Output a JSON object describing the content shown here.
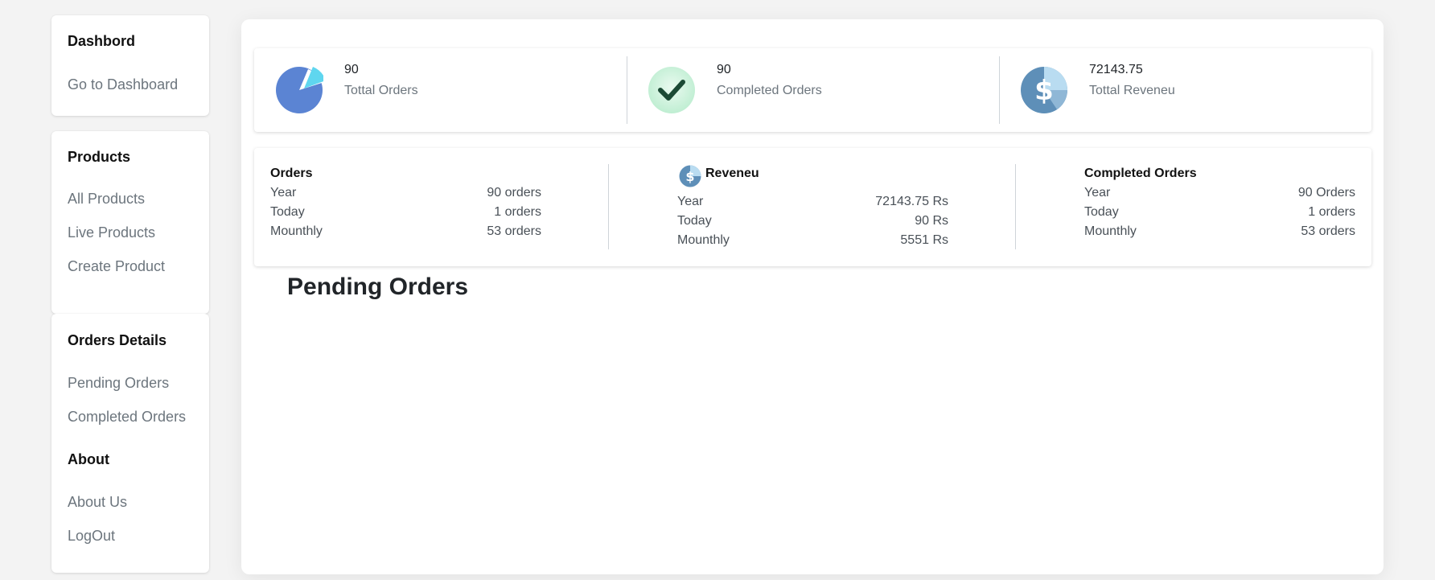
{
  "sidebar": {
    "dashboard": {
      "heading": "Dashbord",
      "links": [
        "Go to Dashboard"
      ]
    },
    "products": {
      "heading": "Products",
      "links": [
        "All Products",
        "Live Products",
        "Create Product"
      ]
    },
    "orders": {
      "heading": "Orders Details",
      "links": [
        "Pending Orders",
        "Completed Orders"
      ]
    },
    "about": {
      "heading": "About",
      "links": [
        "About Us",
        "LogOut"
      ]
    }
  },
  "stats": [
    {
      "value": "90",
      "label": "Tottal Orders",
      "icon": "pie-chart-icon"
    },
    {
      "value": "90",
      "label": "Completed Orders",
      "icon": "check-icon"
    },
    {
      "value": "72143.75",
      "label": "Tottal Reveneu",
      "icon": "dollar-coin-icon"
    }
  ],
  "details": {
    "orders": {
      "title": "Orders",
      "rows": [
        {
          "key": "Year",
          "value": "90 orders"
        },
        {
          "key": "Today",
          "value": "1 orders"
        },
        {
          "key": "Mounthly",
          "value": "53 orders"
        }
      ]
    },
    "revenue": {
      "title": "Reveneu",
      "rows": [
        {
          "key": "Year",
          "value": "72143.75 Rs"
        },
        {
          "key": "Today",
          "value": "90 Rs"
        },
        {
          "key": "Mounthly",
          "value": "5551 Rs"
        }
      ]
    },
    "completed": {
      "title": "Completed Orders",
      "rows": [
        {
          "key": "Year",
          "value": "90 Orders"
        },
        {
          "key": "Today",
          "value": "1 orders"
        },
        {
          "key": "Mounthly",
          "value": "53 orders"
        }
      ]
    }
  },
  "pending": {
    "title": "Pending Orders"
  },
  "colors": {
    "pie_blue": "#5b84d3",
    "pie_cyan": "#5fd6ef",
    "check_bg": "#c8f0d8",
    "check_mark": "#1c4a35",
    "coin_blue": "#5e8fb8",
    "coin_light": "#b9dcf1"
  }
}
